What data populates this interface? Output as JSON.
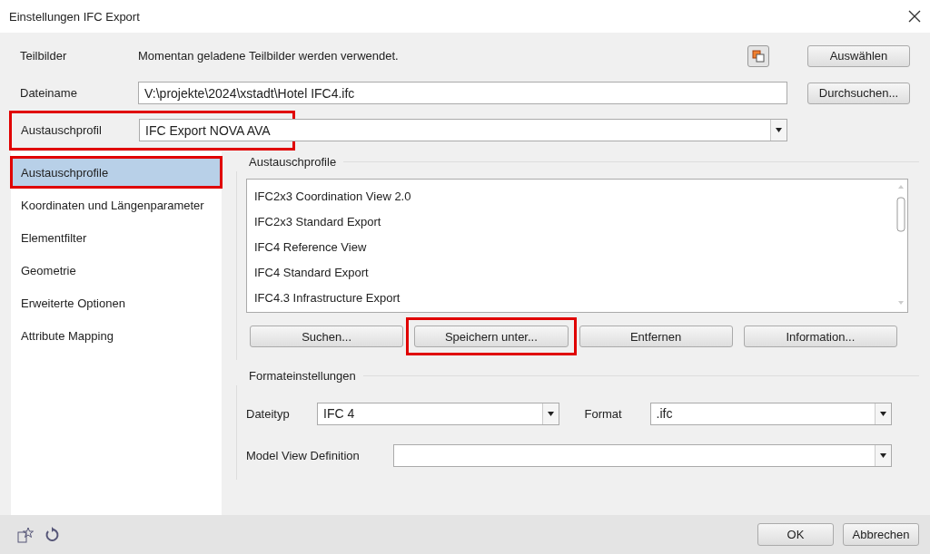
{
  "window": {
    "title": "Einstellungen IFC Export"
  },
  "fields": {
    "teilbilder": {
      "label": "Teilbilder",
      "value": "Momentan geladene Teilbilder werden verwendet.",
      "button": "Auswählen"
    },
    "dateiname": {
      "label": "Dateiname",
      "value": "V:\\projekte\\2024\\xstadt\\Hotel IFC4.ifc",
      "button": "Durchsuchen..."
    },
    "austauschprofil": {
      "label": "Austauschprofil",
      "value": "IFC Export NOVA AVA",
      "highlighted": true
    }
  },
  "sidebar": {
    "items": [
      {
        "label": "Austauschprofile",
        "selected": true,
        "highlighted": true
      },
      {
        "label": "Koordinaten und Längenparameter",
        "selected": false,
        "highlighted": false
      },
      {
        "label": "Elementfilter",
        "selected": false,
        "highlighted": false
      },
      {
        "label": "Geometrie",
        "selected": false,
        "highlighted": false
      },
      {
        "label": "Erweiterte Optionen",
        "selected": false,
        "highlighted": false
      },
      {
        "label": "Attribute Mapping",
        "selected": false,
        "highlighted": false
      }
    ]
  },
  "profiles": {
    "title": "Austauschprofile",
    "items": [
      "IFC2x3 Coordination View 2.0",
      "IFC2x3 Standard Export",
      "IFC4 Reference View",
      "IFC4 Standard Export",
      "IFC4.3 Infrastructure Export"
    ],
    "buttons": [
      {
        "label": "Suchen...",
        "highlighted": false
      },
      {
        "label": "Speichern unter...",
        "highlighted": true
      },
      {
        "label": "Entfernen",
        "highlighted": false
      },
      {
        "label": "Information...",
        "highlighted": false
      }
    ]
  },
  "format": {
    "title": "Formateinstellungen",
    "dateityp_label": "Dateityp",
    "dateityp": "IFC 4",
    "format_label": "Format",
    "format": ".ifc",
    "mvd_label": "Model View Definition"
  },
  "footer": {
    "buttons": [
      "OK",
      "Abbrechen"
    ]
  }
}
